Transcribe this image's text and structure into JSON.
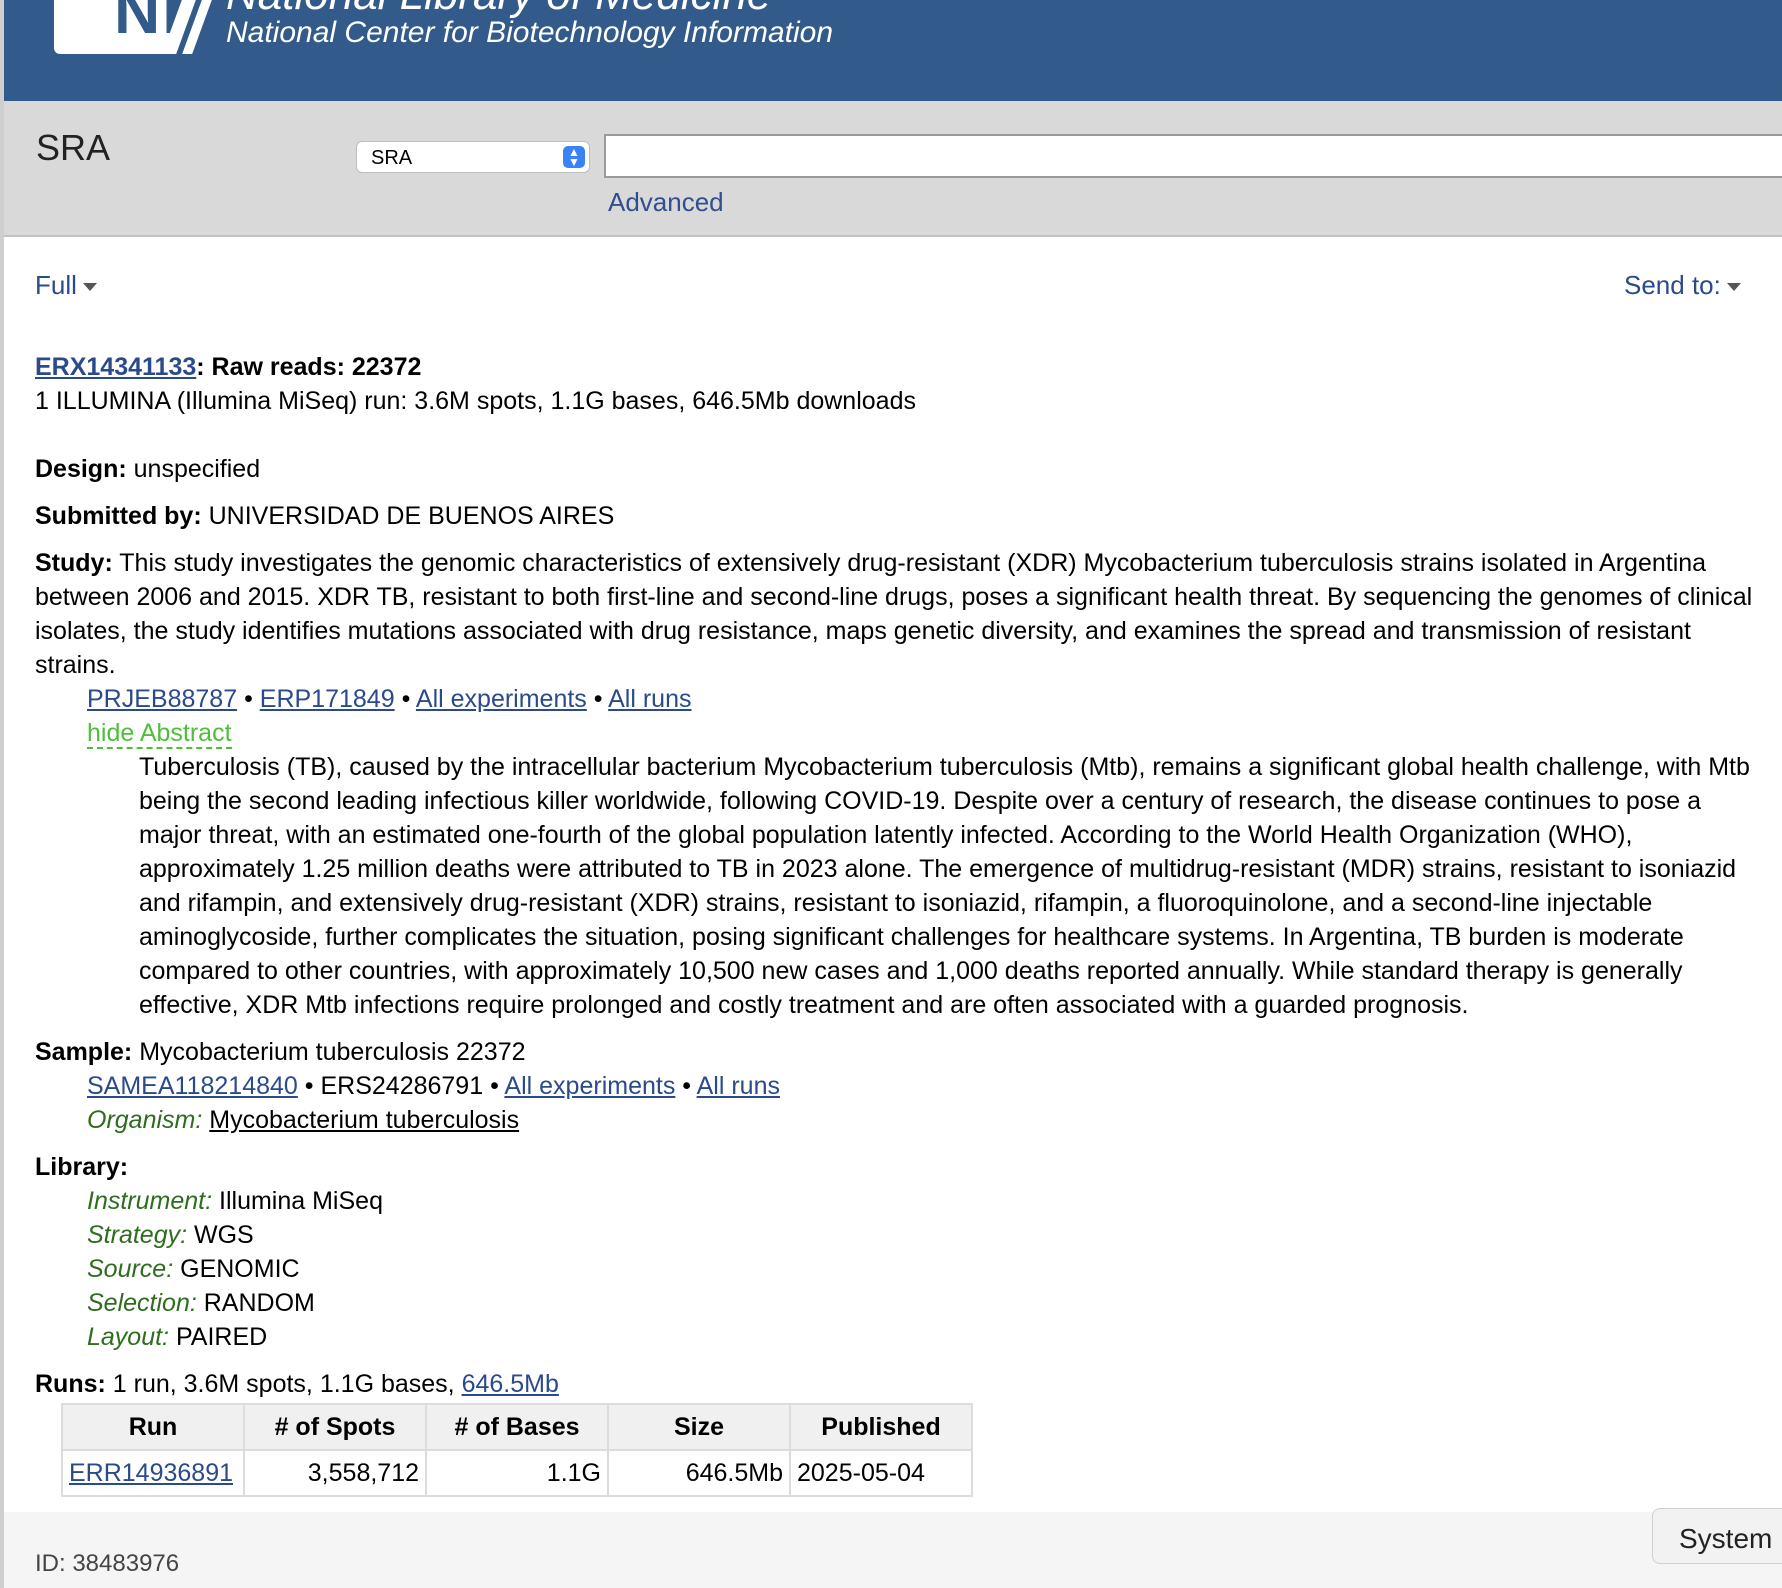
{
  "header": {
    "logo_text": "NIH",
    "nlm_title": "National Library of Medicine",
    "subtitle": "National Center for Biotechnology Information"
  },
  "search": {
    "db_title": "SRA",
    "db_selected": "SRA",
    "query": "",
    "advanced_label": "Advanced"
  },
  "toolbar": {
    "display_label": "Full",
    "send_to_label": "Send to:"
  },
  "record": {
    "accession": "ERX14341133",
    "title_suffix": ": Raw reads: 22372",
    "summary": "1 ILLUMINA (Illumina MiSeq) run: 3.6M spots, 1.1G bases, 646.5Mb downloads",
    "design_label": "Design:",
    "design_value": "unspecified",
    "submitted_label": "Submitted by:",
    "submitted_value": "UNIVERSIDAD DE BUENOS AIRES",
    "study_label": "Study:",
    "study_text": "This study investigates the genomic characteristics of extensively drug-resistant (XDR) Mycobacterium tuberculosis strains isolated in Argentina between 2006 and 2015. XDR TB, resistant to both first-line and second-line drugs, poses a significant health threat. By sequencing the genomes of clinical isolates, the study identifies mutations associated with drug resistance, maps genetic diversity, and examines the spread and transmission of resistant strains.",
    "study_links": {
      "project": "PRJEB88787",
      "study": "ERP171849",
      "all_experiments": "All experiments",
      "all_runs": "All runs",
      "separator": "•"
    },
    "hide_abstract": "hide Abstract",
    "abstract": "Tuberculosis (TB), caused by the intracellular bacterium Mycobacterium tuberculosis (Mtb), remains a significant global health challenge, with Mtb being the second leading infectious killer worldwide, following COVID-19. Despite over a century of research, the disease continues to pose a major threat, with an estimated one-fourth of the global population latently infected. According to the World Health Organization (WHO), approximately 1.25 million deaths were attributed to TB in 2023 alone. The emergence of multidrug-resistant (MDR) strains, resistant to isoniazid and rifampin, and extensively drug-resistant (XDR) strains, resistant to isoniazid, rifampin, a fluoroquinolone, and a second-line injectable aminoglycoside, further complicates the situation, posing significant challenges for healthcare systems. In Argentina, TB burden is moderate compared to other countries, with approximately 10,500 new cases and 1,000 deaths reported annually. While standard therapy is generally effective, XDR Mtb infections require prolonged and costly treatment and are often associated with a guarded prognosis.",
    "sample_label": "Sample:",
    "sample_value": "Mycobacterium tuberculosis 22372",
    "sample_links": {
      "biosample": "SAMEA118214840",
      "ers": "ERS24286791",
      "all_experiments": "All experiments",
      "all_runs": "All runs"
    },
    "organism_label": "Organism:",
    "organism_value": "Mycobacterium tuberculosis",
    "library_label": "Library:",
    "library": {
      "instrument_label": "Instrument:",
      "instrument": "Illumina MiSeq",
      "strategy_label": "Strategy:",
      "strategy": "WGS",
      "source_label": "Source:",
      "source": "GENOMIC",
      "selection_label": "Selection:",
      "selection": "RANDOM",
      "layout_label": "Layout:",
      "layout": "PAIRED"
    },
    "runs_label": "Runs:",
    "runs_summary": "1 run, 3.6M spots, 1.1G bases,",
    "runs_download": "646.5Mb",
    "runs_table": {
      "headers": [
        "Run",
        "# of Spots",
        "# of Bases",
        "Size",
        "Published"
      ],
      "rows": [
        [
          "ERR14936891",
          "3,558,712",
          "1.1G",
          "646.5Mb",
          "2025-05-04"
        ]
      ]
    }
  },
  "footer": {
    "id_text": "ID: 38483976",
    "system_button": "System"
  },
  "colors": {
    "header_bg": "#325a8a",
    "link": "#2a4a8c",
    "green_label": "#2e6d1e",
    "hide_abstract": "#4fbf3a"
  }
}
